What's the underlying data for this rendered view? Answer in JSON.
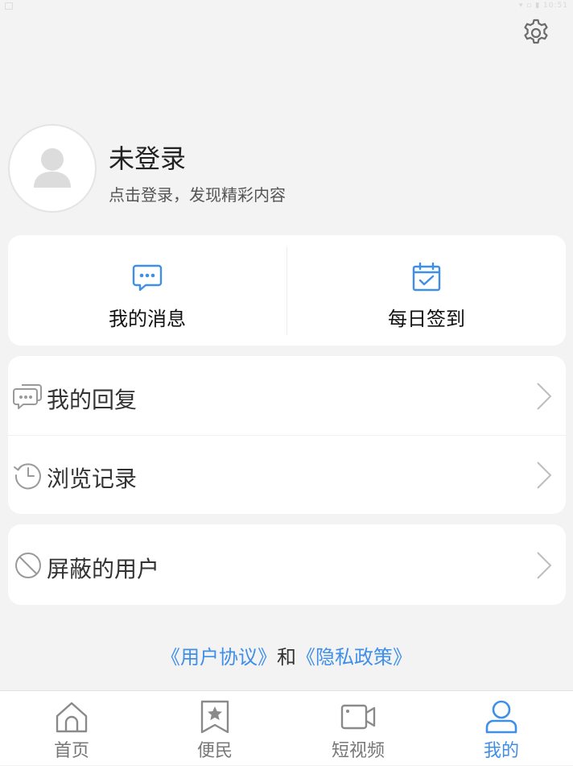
{
  "status_bar": {
    "right_text": "▾ ▫ ▮ 10:51"
  },
  "header": {
    "settings_icon": "gear-icon"
  },
  "profile": {
    "avatar_icon": "person-icon",
    "name": "未登录",
    "hint": "点击登录，发现精彩内容"
  },
  "quick_actions": [
    {
      "label": "我的消息",
      "icon": "chat-bubble-icon"
    },
    {
      "label": "每日签到",
      "icon": "calendar-check-icon"
    }
  ],
  "menu": {
    "group1": [
      {
        "label": "我的回复",
        "icon": "comments-icon"
      },
      {
        "label": "浏览记录",
        "icon": "history-icon"
      }
    ],
    "group2": [
      {
        "label": "屏蔽的用户",
        "icon": "block-icon"
      }
    ]
  },
  "agreement": {
    "user_agreement": "《用户协议》",
    "and": "和",
    "privacy_policy": "《隐私政策》"
  },
  "tabs": [
    {
      "label": "首页",
      "icon": "home-icon",
      "active": false
    },
    {
      "label": "便民",
      "icon": "bookmark-star-icon",
      "active": false
    },
    {
      "label": "短视频",
      "icon": "video-camera-icon",
      "active": false
    },
    {
      "label": "我的",
      "icon": "user-icon",
      "active": true
    }
  ],
  "colors": {
    "accent": "#3f8fe8",
    "background": "#f3f3f3",
    "card": "#ffffff",
    "icon_gray": "#9a9a9a"
  }
}
